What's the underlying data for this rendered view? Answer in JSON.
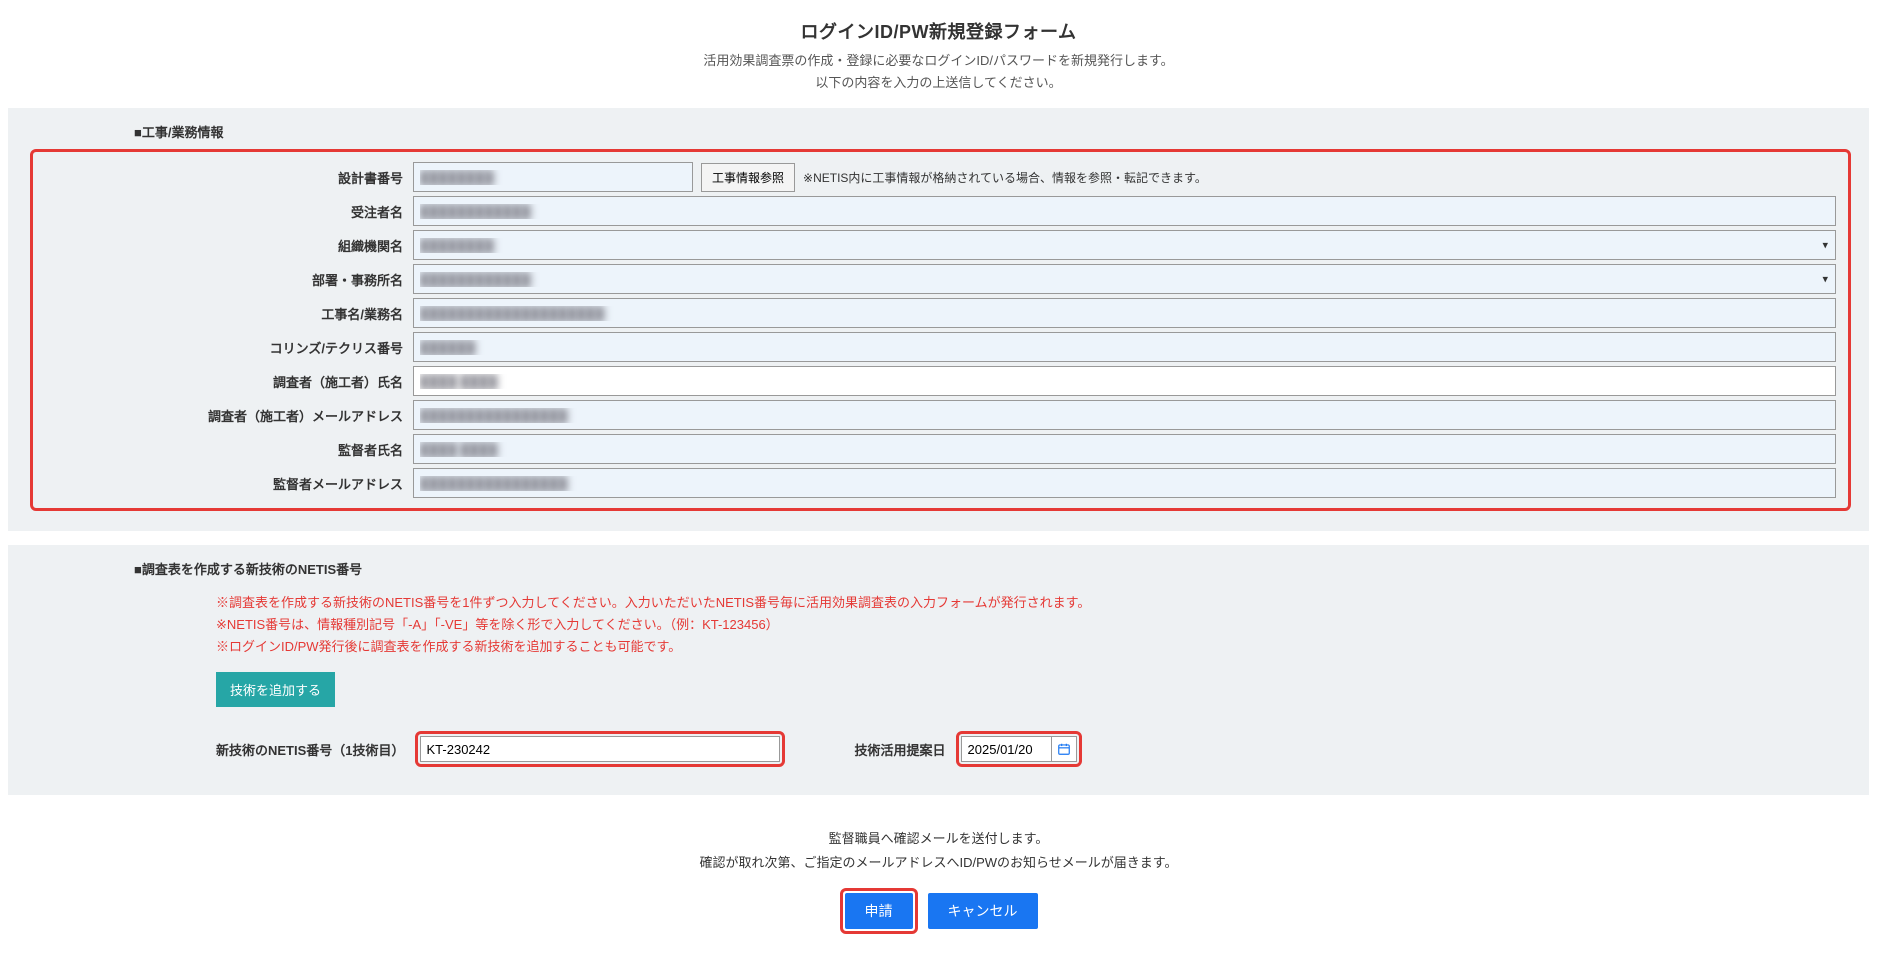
{
  "header": {
    "title": "ログインID/PW新規登録フォーム",
    "subtitle1": "活用効果調査票の作成・登録に必要なログインID/パスワードを新規発行します。",
    "subtitle2": "以下の内容を入力の上送信してください。"
  },
  "section1": {
    "heading": "■工事/業務情報",
    "rows": {
      "design_no": {
        "label": "設計書番号",
        "value": "████████"
      },
      "ref_btn": "工事情報参照",
      "ref_note": "※NETIS内に工事情報が格納されている場合、情報を参照・転記できます。",
      "contractor": {
        "label": "受注者名",
        "value": "████████████"
      },
      "org": {
        "label": "組織機関名",
        "value": "████████"
      },
      "dept": {
        "label": "部署・事務所名",
        "value": "████████████"
      },
      "project": {
        "label": "工事名/業務名",
        "value": "████████████████████"
      },
      "corins": {
        "label": "コリンズ/テクリス番号",
        "value": "██████"
      },
      "investigator": {
        "label": "調査者（施工者）氏名",
        "value": "████ ████"
      },
      "investigator_mail": {
        "label": "調査者（施工者）メールアドレス",
        "value": "████████████████"
      },
      "supervisor": {
        "label": "監督者氏名",
        "value": "████ ████"
      },
      "supervisor_mail": {
        "label": "監督者メールアドレス",
        "value": "████████████████"
      }
    }
  },
  "section2": {
    "heading": "■調査表を作成する新技術のNETIS番号",
    "info1": "※調査表を作成する新技術のNETIS番号を1件ずつ入力してください。入力いただいたNETIS番号毎に活用効果調査表の入力フォームが発行されます。",
    "info2": "※NETIS番号は、情報種別記号「-A」「-VE」等を除く形で入力してください。（例：KT-123456）",
    "info3": "※ログインID/PW発行後に調査表を作成する新技術を追加することも可能です。",
    "add_btn": "技術を追加する",
    "netis_label": "新技術のNETIS番号（1技術目）",
    "netis_value": "KT-230242",
    "date_label": "技術活用提案日",
    "date_value": "2025/01/20"
  },
  "footer": {
    "line1": "監督職員へ確認メールを送付します。",
    "line2": "確認が取れ次第、ご指定のメールアドレスへID/PWのお知らせメールが届きます。",
    "submit": "申請",
    "cancel": "キャンセル"
  }
}
